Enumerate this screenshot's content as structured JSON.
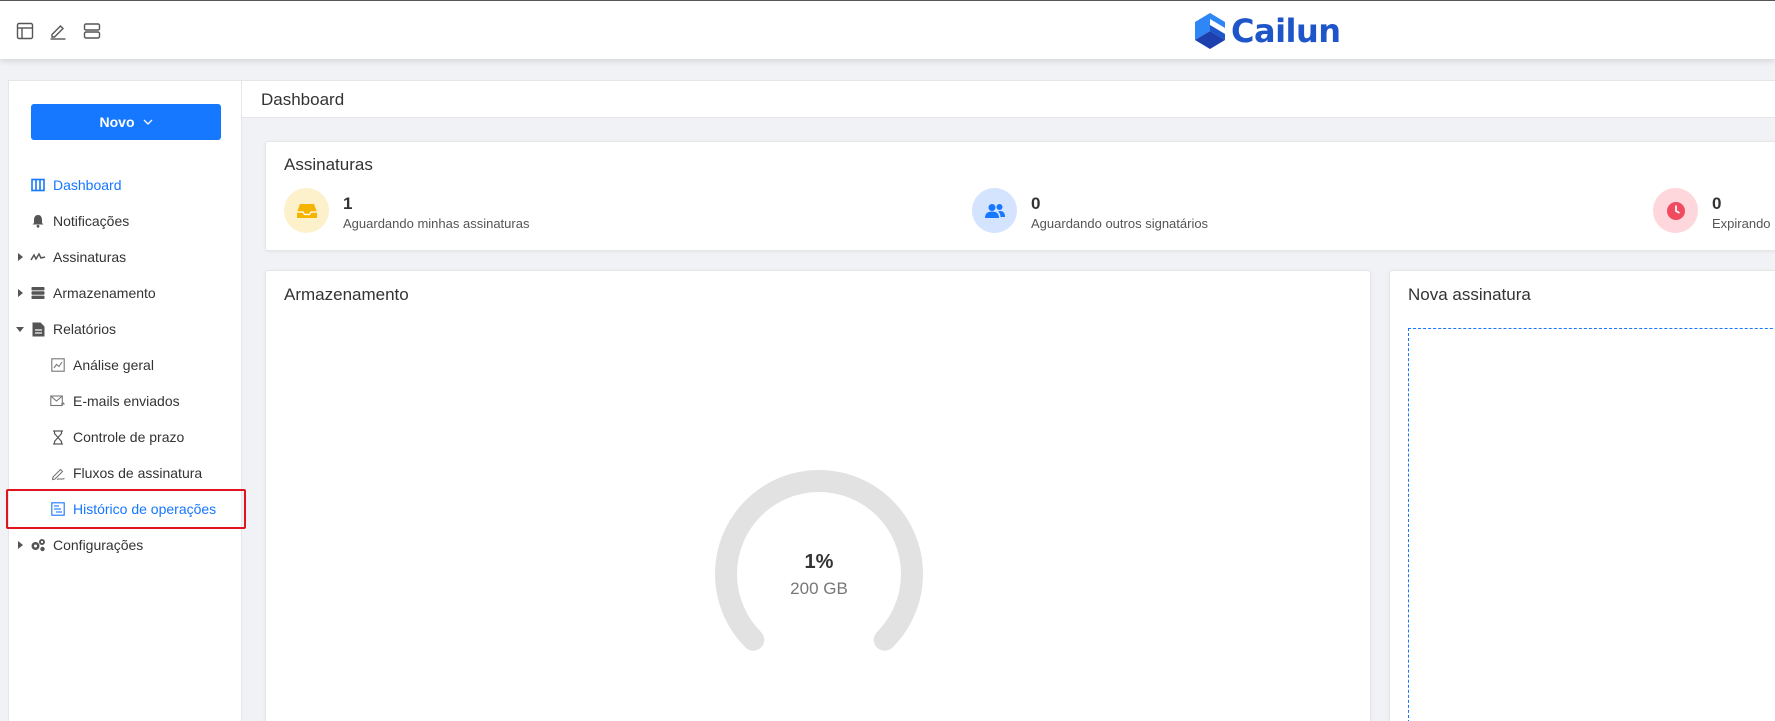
{
  "topbar": {
    "icons": [
      "layout-icon",
      "edit-icon",
      "server-icon"
    ],
    "logo_text": "Cailun"
  },
  "sidebar": {
    "new_button_label": "Novo",
    "items": [
      {
        "label": "Dashboard",
        "icon": "dashboard-icon",
        "active": true
      },
      {
        "label": "Notificações",
        "icon": "bell-icon"
      },
      {
        "label": "Assinaturas",
        "icon": "signature-icon",
        "collapsed": true
      },
      {
        "label": "Armazenamento",
        "icon": "storage-icon",
        "collapsed": true
      },
      {
        "label": "Relatórios",
        "icon": "report-icon",
        "expanded": true
      },
      {
        "label": "Análise geral",
        "icon": "chart-icon",
        "sub": true
      },
      {
        "label": "E-mails enviados",
        "icon": "mail-sent-icon",
        "sub": true
      },
      {
        "label": "Controle de prazo",
        "icon": "hourglass-icon",
        "sub": true
      },
      {
        "label": "Fluxos de assinatura",
        "icon": "pen-icon",
        "sub": true
      },
      {
        "label": "Histórico de operações",
        "icon": "history-list-icon",
        "sub": true,
        "active": true,
        "highlighted": true
      },
      {
        "label": "Configurações",
        "icon": "gears-icon",
        "collapsed": true
      }
    ]
  },
  "main": {
    "page_title": "Dashboard",
    "signatures": {
      "title": "Assinaturas",
      "stats": [
        {
          "value": "1",
          "label": "Aguardando minhas assinaturas",
          "icon": "inbox-icon",
          "color": "#f5b400",
          "bg": "#fdf1cc"
        },
        {
          "value": "0",
          "label": "Aguardando outros signatários",
          "icon": "users-icon",
          "color": "#1677ff",
          "bg": "#d4e4ff"
        },
        {
          "value": "0",
          "label": "Expirando",
          "icon": "clock-icon",
          "color": "#f04b5f",
          "bg": "#fdd7dc"
        }
      ]
    },
    "storage": {
      "title": "Armazenamento",
      "usage_percent": 1,
      "percent_label": "1%",
      "capacity_label": "200 GB"
    },
    "new_signature": {
      "title": "Nova assinatura"
    }
  },
  "colors": {
    "primary": "#1677ff",
    "highlight": "#e0141e",
    "logo": "#1e55c8"
  }
}
